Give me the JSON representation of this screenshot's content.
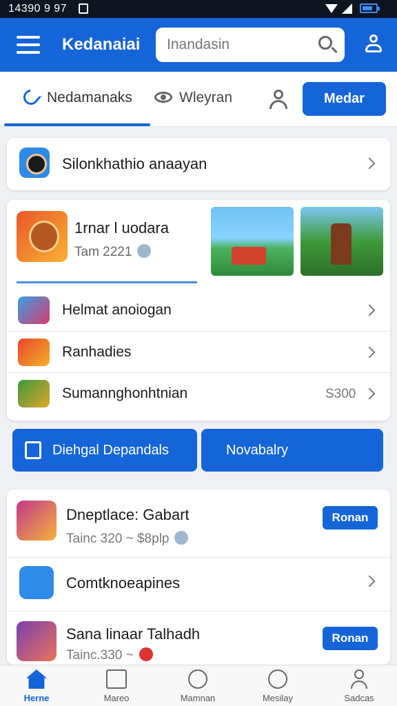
{
  "status_bar": {
    "time": "14390 9 97"
  },
  "header": {
    "title": "Kedanaiai",
    "search_placeholder": "Inandasin",
    "icons": {
      "menu": "hamburger-icon",
      "search": "search-icon",
      "account": "account-icon"
    }
  },
  "tabs": [
    {
      "label": "Nedamanaks",
      "icon": "phone-icon",
      "active": true
    },
    {
      "label": "Wleyran",
      "icon": "eye-icon",
      "active": false
    }
  ],
  "tabs_action": {
    "label": "Medar"
  },
  "featured": {
    "label": "Silonkhathio anaayan"
  },
  "hero": {
    "title": "1rnar l uodara",
    "subtitle": "Tam 2221",
    "progress": 1.0
  },
  "rows": [
    {
      "label": "Helmat anoiogan"
    },
    {
      "label": "Ranhadies"
    },
    {
      "label": "Sumannghonhtnian",
      "value": "S300"
    }
  ],
  "actions": {
    "primary": "Diehgal Depandals",
    "secondary": "Novabalry"
  },
  "list": [
    {
      "title": "Dneptlace: Gabart",
      "subtitle": "Tainc 320  ~  $8plp",
      "button": "Ronan"
    },
    {
      "title": "Comtknoeapines"
    },
    {
      "title": "Sana linaar Talhadh",
      "subtitle": "Tainc.330  ~",
      "button": "Ronan"
    }
  ],
  "bottom_nav": [
    {
      "label": "Herne",
      "icon": "home-icon",
      "active": true
    },
    {
      "label": "Mareo",
      "icon": "briefcase-icon"
    },
    {
      "label": "Mamnan",
      "icon": "compass-icon"
    },
    {
      "label": "Mesilay",
      "icon": "smiley-icon"
    },
    {
      "label": "Sadcas",
      "icon": "person-icon"
    }
  ],
  "colors": {
    "primary": "#1565d8",
    "background": "#eef0f3"
  }
}
